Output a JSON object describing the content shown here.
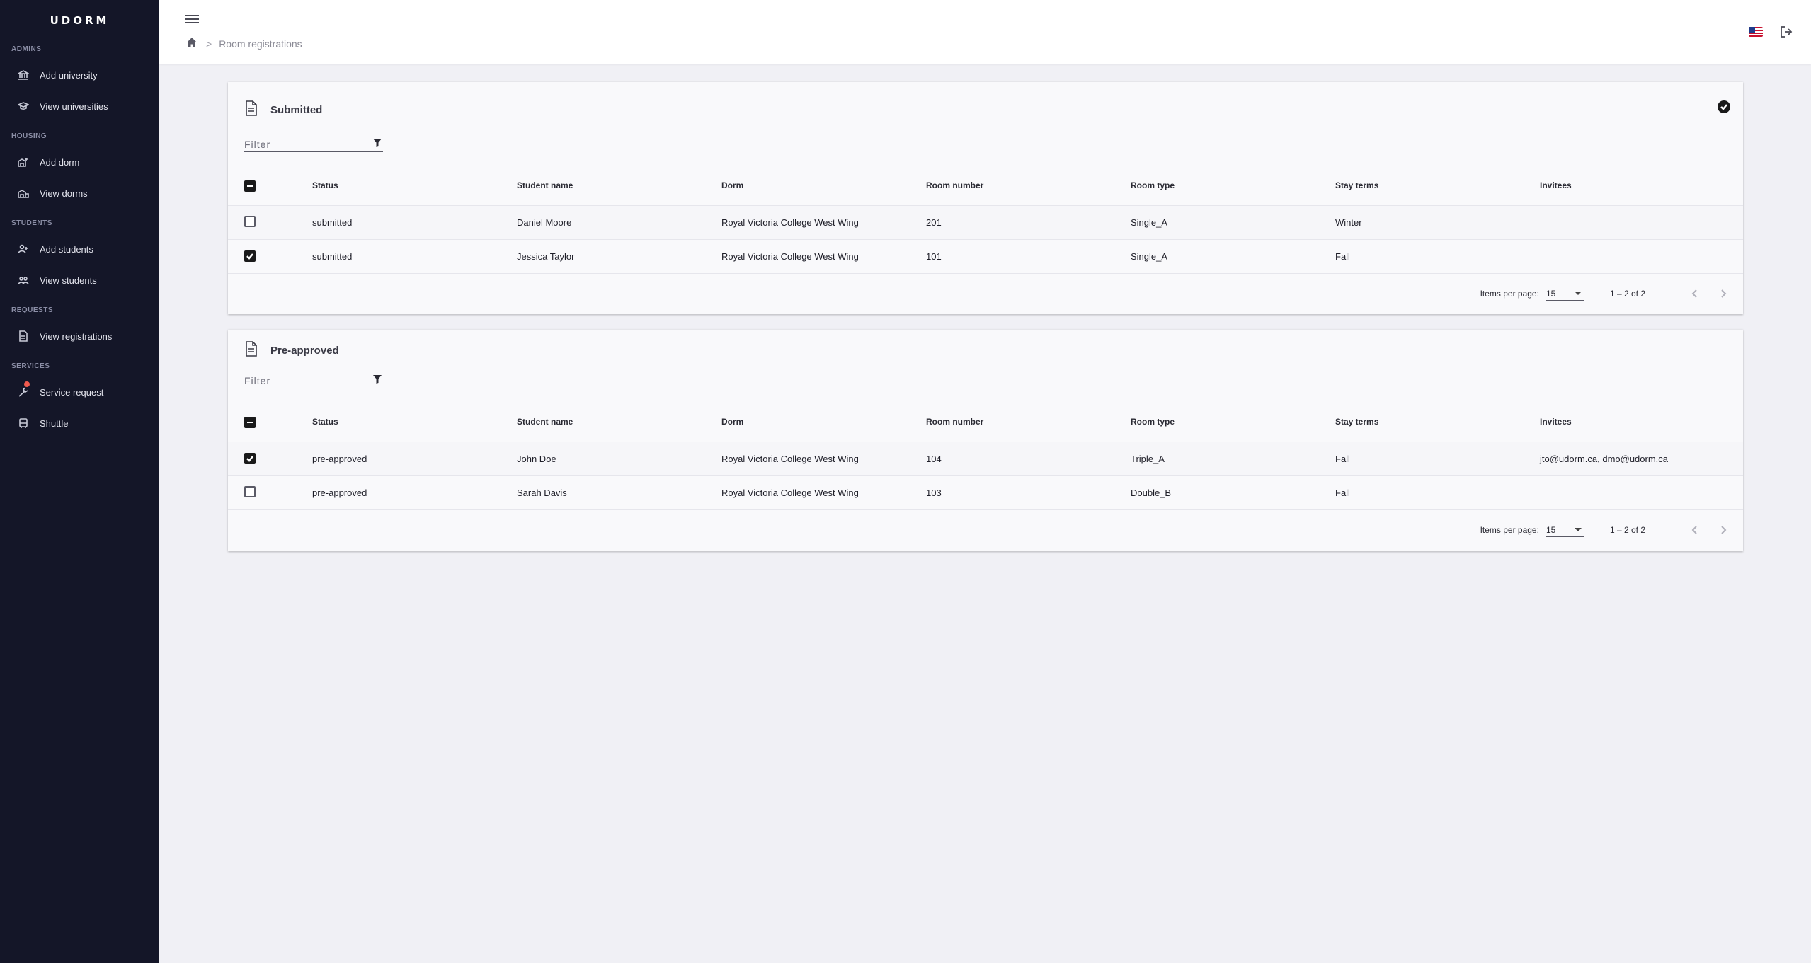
{
  "app": {
    "brand": "UDORM"
  },
  "sidebar": {
    "sections": [
      {
        "title": "ADMINS",
        "items": [
          {
            "label": "Add university",
            "icon": "bank-icon"
          },
          {
            "label": "View universities",
            "icon": "school-icon"
          }
        ]
      },
      {
        "title": "HOUSING",
        "items": [
          {
            "label": "Add dorm",
            "icon": "add-building-icon"
          },
          {
            "label": "View dorms",
            "icon": "building-icon"
          }
        ]
      },
      {
        "title": "STUDENTS",
        "items": [
          {
            "label": "Add students",
            "icon": "add-person-icon"
          },
          {
            "label": "View students",
            "icon": "people-icon"
          }
        ]
      },
      {
        "title": "REQUESTS",
        "items": [
          {
            "label": "View registrations",
            "icon": "document-icon"
          }
        ]
      },
      {
        "title": "SERVICES",
        "items": [
          {
            "label": "Service request",
            "icon": "wrench-icon"
          },
          {
            "label": "Shuttle",
            "icon": "bus-icon"
          }
        ]
      }
    ]
  },
  "header": {
    "breadcrumb_current": "Room registrations",
    "breadcrumb_separator": ">"
  },
  "tables": {
    "columns": [
      "Status",
      "Student name",
      "Dorm",
      "Room number",
      "Room type",
      "Stay terms",
      "Invitees"
    ],
    "submitted": {
      "title": "Submitted",
      "filter_placeholder": "Filter",
      "rows": [
        {
          "checked": false,
          "status": "submitted",
          "student": "Daniel Moore",
          "dorm": "Royal Victoria College West Wing",
          "room": "201",
          "type": "Single_A",
          "terms": "Winter",
          "invitees": ""
        },
        {
          "checked": true,
          "status": "submitted",
          "student": "Jessica Taylor",
          "dorm": "Royal Victoria College West Wing",
          "room": "101",
          "type": "Single_A",
          "terms": "Fall",
          "invitees": ""
        }
      ],
      "paginator": {
        "label": "Items per page:",
        "per_page": "15",
        "range": "1 – 2 of 2"
      }
    },
    "preapproved": {
      "title": "Pre-approved",
      "filter_placeholder": "Filter",
      "rows": [
        {
          "checked": true,
          "status": "pre-approved",
          "student": "John Doe",
          "dorm": "Royal Victoria College West Wing",
          "room": "104",
          "type": "Triple_A",
          "terms": "Fall",
          "invitees": "jto@udorm.ca, dmo@udorm.ca"
        },
        {
          "checked": false,
          "status": "pre-approved",
          "student": "Sarah Davis",
          "dorm": "Royal Victoria College West Wing",
          "room": "103",
          "type": "Double_B",
          "terms": "Fall",
          "invitees": ""
        }
      ],
      "paginator": {
        "label": "Items per page:",
        "per_page": "15",
        "range": "1 – 2 of 2"
      }
    }
  }
}
